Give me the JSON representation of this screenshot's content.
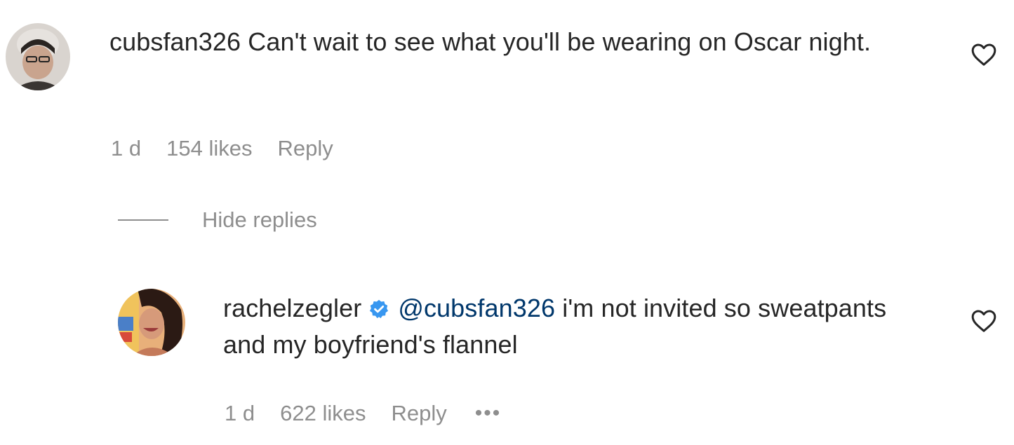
{
  "comments": [
    {
      "username": "cubsfan326",
      "text": "Can't wait to see what you'll be wearing on Oscar night.",
      "time": "1 d",
      "likes": "154 likes",
      "reply_label": "Reply"
    }
  ],
  "hide_replies_label": "Hide replies",
  "replies": [
    {
      "username": "rachelzegler",
      "verified": true,
      "mention": "@cubsfan326",
      "text": "i'm not invited so sweatpants and my boyfriend's flannel",
      "time": "1 d",
      "likes": "622 likes",
      "reply_label": "Reply",
      "more_label": "•••"
    }
  ],
  "colors": {
    "text": "#262626",
    "secondary": "#8e8e8e",
    "mention": "#00376b",
    "verified": "#3897f0"
  },
  "icons": {
    "like": "heart-outline-icon",
    "verified": "verified-badge-icon",
    "more": "more-horizontal-icon"
  }
}
